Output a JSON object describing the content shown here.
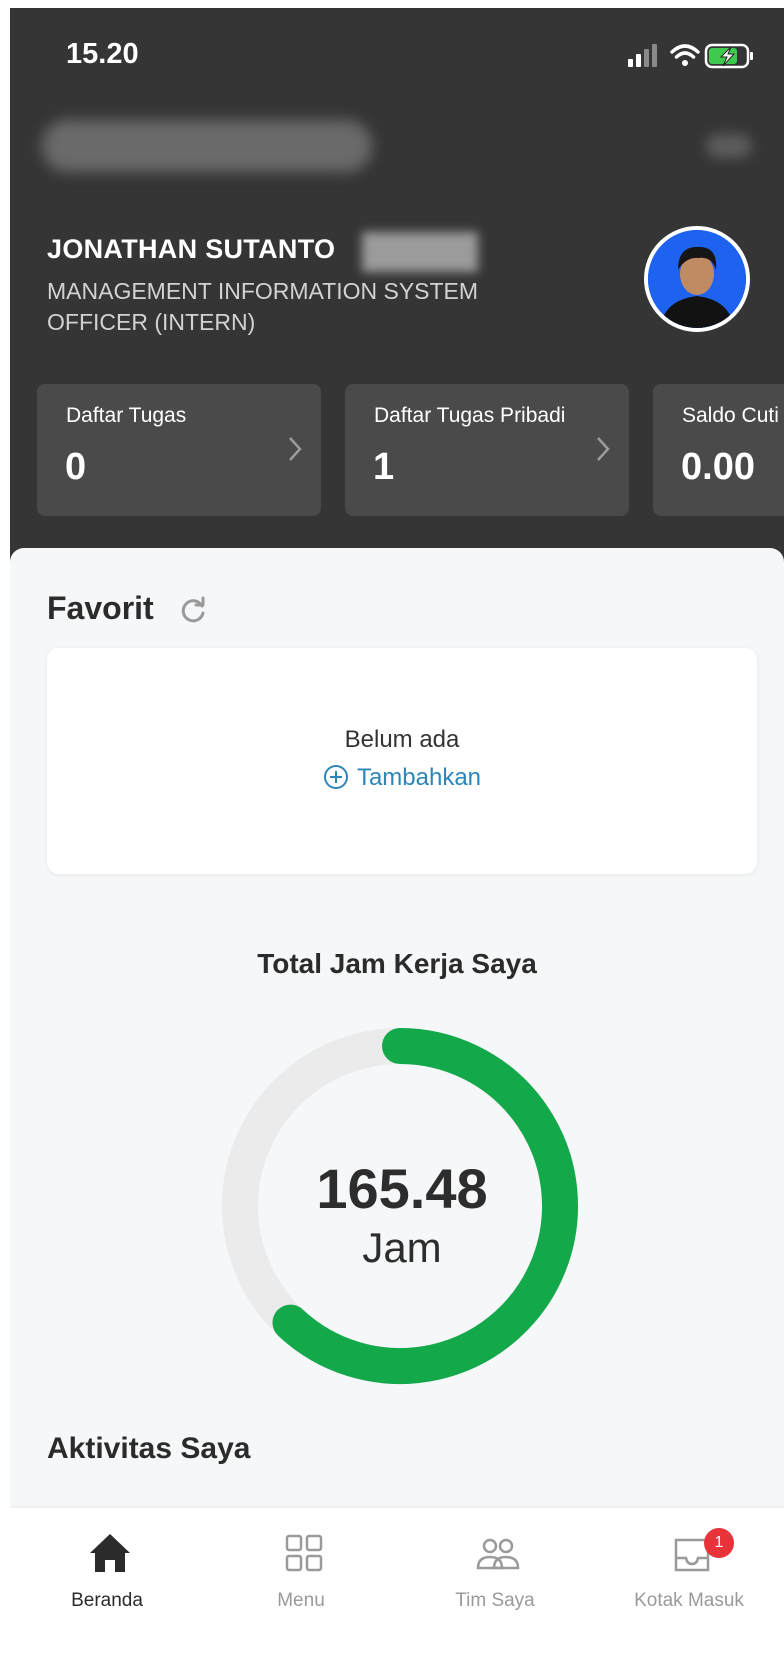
{
  "status_bar": {
    "time": "15.20",
    "signal_icon": "signal-icon",
    "wifi_icon": "wifi-icon",
    "battery_icon": "battery-charging-icon"
  },
  "profile": {
    "name": "JONATHAN SUTANTO",
    "job_title": "MANAGEMENT INFORMATION SYSTEM OFFICER (INTERN)",
    "avatar_color": "#1e63f0"
  },
  "stats": [
    {
      "label": "Daftar Tugas",
      "value": "0"
    },
    {
      "label": "Daftar Tugas Pribadi",
      "value": "1"
    },
    {
      "label": "Saldo Cuti",
      "value": "0.00"
    }
  ],
  "favorites": {
    "title": "Favorit",
    "empty_text": "Belum ada",
    "add_label": "Tambahkan"
  },
  "work_hours": {
    "title": "Total Jam Kerja Saya",
    "value": "165.48",
    "unit": "Jam",
    "progress_fraction": 0.62,
    "progress_color": "#13a84a",
    "track_color": "#ebebeb"
  },
  "activity": {
    "title": "Aktivitas Saya"
  },
  "tabs": [
    {
      "label": "Beranda",
      "icon": "home-icon",
      "active": true
    },
    {
      "label": "Menu",
      "icon": "grid-icon",
      "active": false
    },
    {
      "label": "Tim Saya",
      "icon": "team-icon",
      "active": false
    },
    {
      "label": "Kotak Masuk",
      "icon": "inbox-icon",
      "active": false,
      "badge": "1"
    }
  ],
  "colors": {
    "header_bg": "#353535",
    "card_bg": "#4a4a4a",
    "accent_link": "#2c86b8",
    "badge": "#e8333a"
  }
}
